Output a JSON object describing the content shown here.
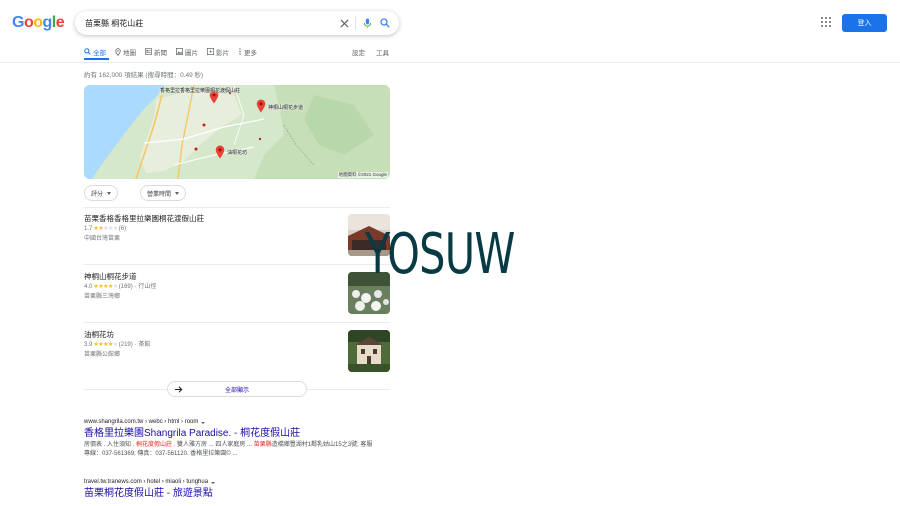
{
  "logo": {
    "letters": [
      "G",
      "o",
      "o",
      "g",
      "l",
      "e"
    ],
    "colors": [
      "#4285f4",
      "#ea4335",
      "#fbbc05",
      "#4285f4",
      "#34a853",
      "#ea4335"
    ]
  },
  "search": {
    "value": "苗栗縣 桐花山莊"
  },
  "header": {
    "login_label": "登入"
  },
  "tabs": [
    {
      "label": "全部",
      "icon": "search-icon",
      "active": true
    },
    {
      "label": "地圖",
      "icon": "map-pin-icon",
      "active": false
    },
    {
      "label": "新聞",
      "icon": "news-icon",
      "active": false
    },
    {
      "label": "圖片",
      "icon": "image-icon",
      "active": false
    },
    {
      "label": "影片",
      "icon": "video-icon",
      "active": false
    },
    {
      "label": "更多",
      "icon": "more-vert-icon",
      "active": false
    }
  ],
  "tools": {
    "settings": "設定",
    "tools": "工具"
  },
  "result_stats": "約有 162,000 項結果 (搜尋時間：0.49 秒)",
  "map": {
    "pins": [
      {
        "label": "香格里拉香格里拉樂園桐花渡假山莊"
      },
      {
        "label": "神桐山桐花步道"
      },
      {
        "label": "油桐花坊"
      }
    ],
    "credit": "地圖資料 ©2021 Google"
  },
  "filters": [
    {
      "label": "評分"
    },
    {
      "label": "營業時間"
    }
  ],
  "places": [
    {
      "name": "苗栗香格香格里拉樂園桐花渡假山莊",
      "rating": "1.7",
      "stars": 2,
      "reviews": "(6)",
      "category": "",
      "address": "中國台灣苗栗"
    },
    {
      "name": "神桐山桐花步道",
      "rating": "4.0",
      "stars": 4,
      "reviews": "(169)",
      "category": "· 行山徑",
      "address": "苗栗縣三灣鄉"
    },
    {
      "name": "油桐花坊",
      "rating": "3.9",
      "stars": 4,
      "reviews": "(219)",
      "category": "· 茶館",
      "address": "苗栗縣公館鄉"
    }
  ],
  "view_all_label": "全部顯示",
  "results": [
    {
      "cite": "www.shangrila.com.tw › webc › html › room",
      "title": "香格里拉樂園Shangrila Paradise. - 桐花度假山莊",
      "snippet_parts": [
        {
          "text": "房價表 . 入住須知 . ",
          "em": false
        },
        {
          "text": "桐花度假山莊",
          "em": true
        },
        {
          "text": " . 雙人雅方房 ... 四人家庭房 ... ",
          "em": false
        },
        {
          "text": "苗栗縣",
          "em": true
        },
        {
          "text": "造橋鄉豐湖村1鄰乳姑山15之3號; 客服專線：037-561369; 傳真：037-561120. 香格里拉樂園© ...",
          "em": false
        }
      ]
    },
    {
      "cite": "travel.tw.tranews.com › hotel › miaoli › tunghua",
      "title": "苗栗桐花度假山莊 - 旅遊景點",
      "snippet_parts": []
    }
  ],
  "watermark": "YOSUW"
}
